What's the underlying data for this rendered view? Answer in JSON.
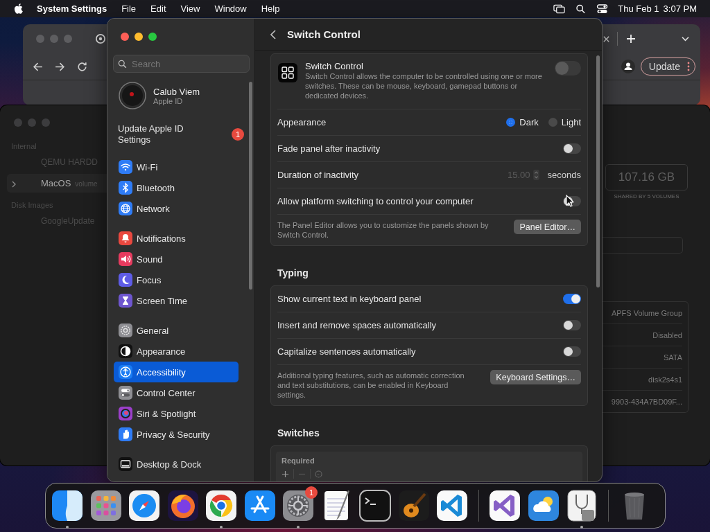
{
  "menu_bar": {
    "app": "System Settings",
    "menus": [
      "File",
      "Edit",
      "View",
      "Window",
      "Help"
    ],
    "date": "Thu Feb 1",
    "time": "3:07 PM"
  },
  "browser_window": {
    "update_button": "Update"
  },
  "disk_utility": {
    "sidebar": [
      {
        "kind": "section",
        "label": "Internal"
      },
      {
        "kind": "disk",
        "label": "QEMU HARDD",
        "selected": false
      },
      {
        "kind": "volume",
        "label": "MacOS",
        "detail": "volume",
        "selected": true
      },
      {
        "kind": "section",
        "label": "Disk Images"
      },
      {
        "kind": "disk",
        "label": "GoogleUpdate",
        "selected": false
      }
    ],
    "capacity": "107.16 GB",
    "capacity_note": "SHARED BY 5 VOLUMES",
    "info": [
      "APFS Volume Group",
      "Disabled",
      "SATA",
      "disk2s4s1",
      "9903-434A7BD09F..."
    ]
  },
  "settings": {
    "search": {
      "placeholder": "Search"
    },
    "account": {
      "name": "Calub Viem",
      "subtitle": "Apple ID"
    },
    "update_notice": {
      "label": "Update Apple ID Settings",
      "badge": "1"
    },
    "sidebar_groups": [
      [
        {
          "label": "Wi-Fi",
          "kind": "wifi",
          "color": "#2f7cf6",
          "selected": false
        },
        {
          "label": "Bluetooth",
          "kind": "bluetooth",
          "color": "#2f7cf6",
          "selected": false
        },
        {
          "label": "Network",
          "kind": "globe",
          "color": "#2f7cf6",
          "selected": false
        }
      ],
      [
        {
          "label": "Notifications",
          "kind": "bell",
          "color": "#e9483f",
          "selected": false
        },
        {
          "label": "Sound",
          "kind": "speaker",
          "color": "#e63b5f",
          "selected": false
        },
        {
          "label": "Focus",
          "kind": "moon",
          "color": "#5e5ce6",
          "selected": false
        },
        {
          "label": "Screen Time",
          "kind": "hourglass",
          "color": "#6e56cf",
          "selected": false
        }
      ],
      [
        {
          "label": "General",
          "kind": "gear",
          "color": "#8e8e93",
          "selected": false
        },
        {
          "label": "Appearance",
          "kind": "contrast",
          "color": "#111111",
          "selected": false
        },
        {
          "label": "Accessibility",
          "kind": "person",
          "color": "#1b7cf3",
          "selected": true
        },
        {
          "label": "Control Center",
          "kind": "switches",
          "color": "#8e8e93",
          "selected": false
        },
        {
          "label": "Siri & Spotlight",
          "kind": "orb",
          "color": "#9b3fc9",
          "selected": false
        },
        {
          "label": "Privacy & Security",
          "kind": "hand",
          "color": "#2f7cf6",
          "selected": false
        }
      ],
      [
        {
          "label": "Desktop & Dock",
          "kind": "dock",
          "color": "#111111",
          "selected": false
        }
      ]
    ],
    "page": {
      "title": "Switch Control",
      "sections": [
        {
          "rows": [
            {
              "kind": "intro",
              "title": "Switch Control",
              "text": "Switch Control allows the computer to be controlled using one or more switches. These can be mouse, keyboard, gamepad buttons or dedicated devices.",
              "on": false
            },
            {
              "kind": "radio",
              "label": "Appearance",
              "options": [
                {
                  "label": "Dark",
                  "selected": true
                },
                {
                  "label": "Light",
                  "selected": false
                }
              ]
            },
            {
              "kind": "toggle",
              "label": "Fade panel after inactivity",
              "on": false
            },
            {
              "kind": "stepper",
              "label": "Duration of inactivity",
              "value": "15.00",
              "unit": "seconds",
              "disabled": true
            },
            {
              "kind": "toggle",
              "label": "Allow platform switching to control your computer",
              "on": false
            },
            {
              "kind": "note",
              "text": "The Panel Editor allows you to customize the panels shown by Switch Control.",
              "button": "Panel Editor…"
            }
          ]
        },
        {
          "heading": "Typing",
          "rows": [
            {
              "kind": "toggle",
              "label": "Show current text in keyboard panel",
              "on": true
            },
            {
              "kind": "toggle",
              "label": "Insert and remove spaces automatically",
              "on": false
            },
            {
              "kind": "toggle",
              "label": "Capitalize sentences automatically",
              "on": false
            },
            {
              "kind": "note",
              "text": "Additional typing features, such as automatic correction and text substitutions, can be enabled in Keyboard settings.",
              "button": "Keyboard Settings…"
            }
          ]
        },
        {
          "heading": "Switches",
          "rows": [
            {
              "kind": "list",
              "header": "Required"
            }
          ]
        }
      ]
    }
  },
  "dock": [
    {
      "kind": "finder",
      "running": true
    },
    {
      "kind": "launchpad",
      "running": false
    },
    {
      "kind": "safari",
      "running": false
    },
    {
      "kind": "firefox",
      "running": false
    },
    {
      "kind": "chrome",
      "running": true
    },
    {
      "kind": "appstore",
      "running": false
    },
    {
      "kind": "settings",
      "running": true,
      "badge": "1"
    },
    {
      "kind": "textedit",
      "running": false
    },
    {
      "kind": "terminal",
      "running": false
    },
    {
      "kind": "guitar",
      "running": false
    },
    {
      "kind": "vscode",
      "running": false
    },
    {
      "kind": "divider"
    },
    {
      "kind": "vstudio",
      "running": false
    },
    {
      "kind": "weather",
      "running": false
    },
    {
      "kind": "diskutil",
      "running": true
    },
    {
      "kind": "divider"
    },
    {
      "kind": "trash",
      "running": false
    }
  ]
}
